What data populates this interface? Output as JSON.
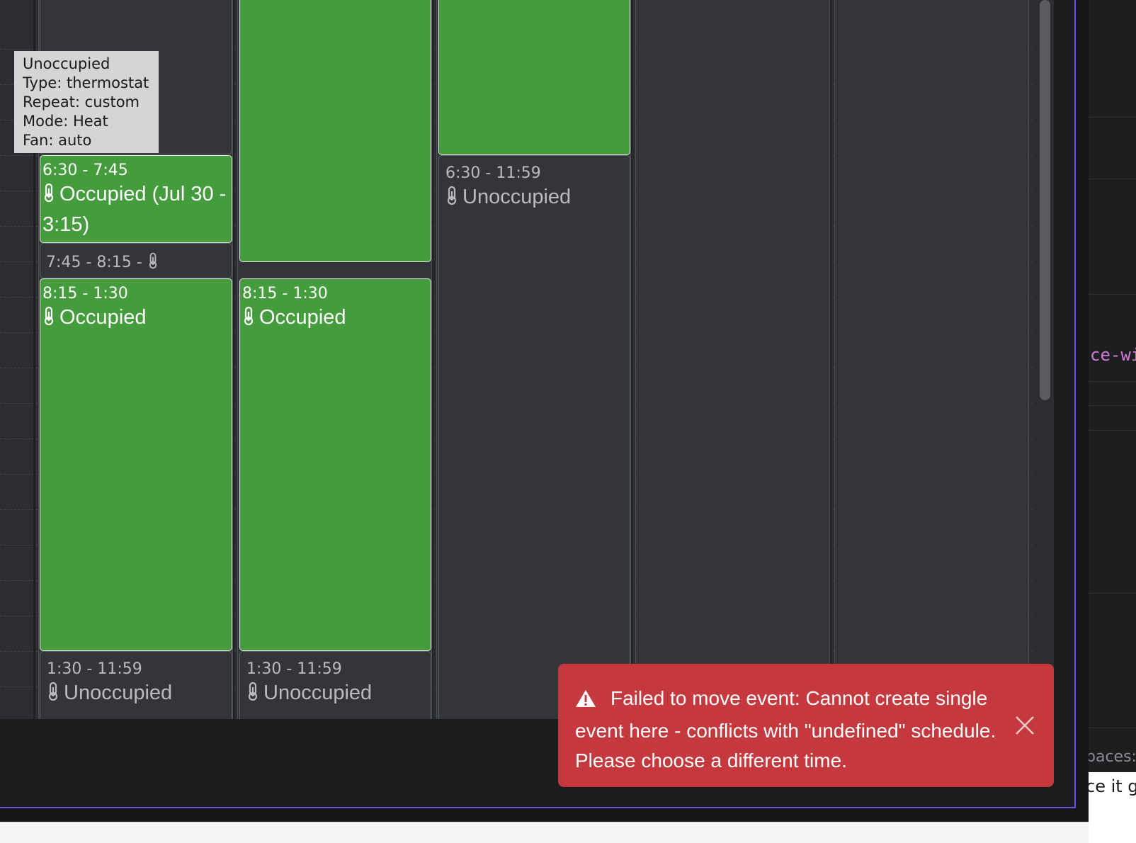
{
  "tooltip": {
    "lines": [
      "Unoccupied",
      "Type: thermostat",
      "Repeat: custom",
      "Mode: Heat",
      "Fan: auto"
    ]
  },
  "col1": {
    "ev1": {
      "time": "6:30 - 7:45",
      "title": "Occupied (Jul 30 - 3:15)"
    },
    "ev2": {
      "time": "7:45 - 8:15 -"
    },
    "ev3": {
      "time": "8:15 - 1:30",
      "title": "Occupied"
    },
    "ev4": {
      "time": "1:30 - 11:59",
      "title": "Unoccupied"
    }
  },
  "col2": {
    "ev2": {
      "time": "8:15 - 1:30",
      "title": "Occupied"
    },
    "ev3": {
      "time": "1:30 - 11:59",
      "title": "Unoccupied"
    }
  },
  "col3": {
    "ev2": {
      "time": "6:30 - 11:59",
      "title": "Unoccupied"
    }
  },
  "toast": {
    "message": "Failed to move event: Cannot create single event here - conflicts with \"undefined\" schedule. Please choose a different time."
  },
  "right": {
    "code": "ce-wi",
    "spaces": "paces:",
    "text": "ce it g"
  },
  "colors": {
    "occupied": "#449c3c",
    "unoccupied": "#33353b",
    "error": "#c5393e",
    "frame_accent": "#6a55e0"
  },
  "icons": [
    "thermometer-icon",
    "warning-icon",
    "close-icon"
  ]
}
